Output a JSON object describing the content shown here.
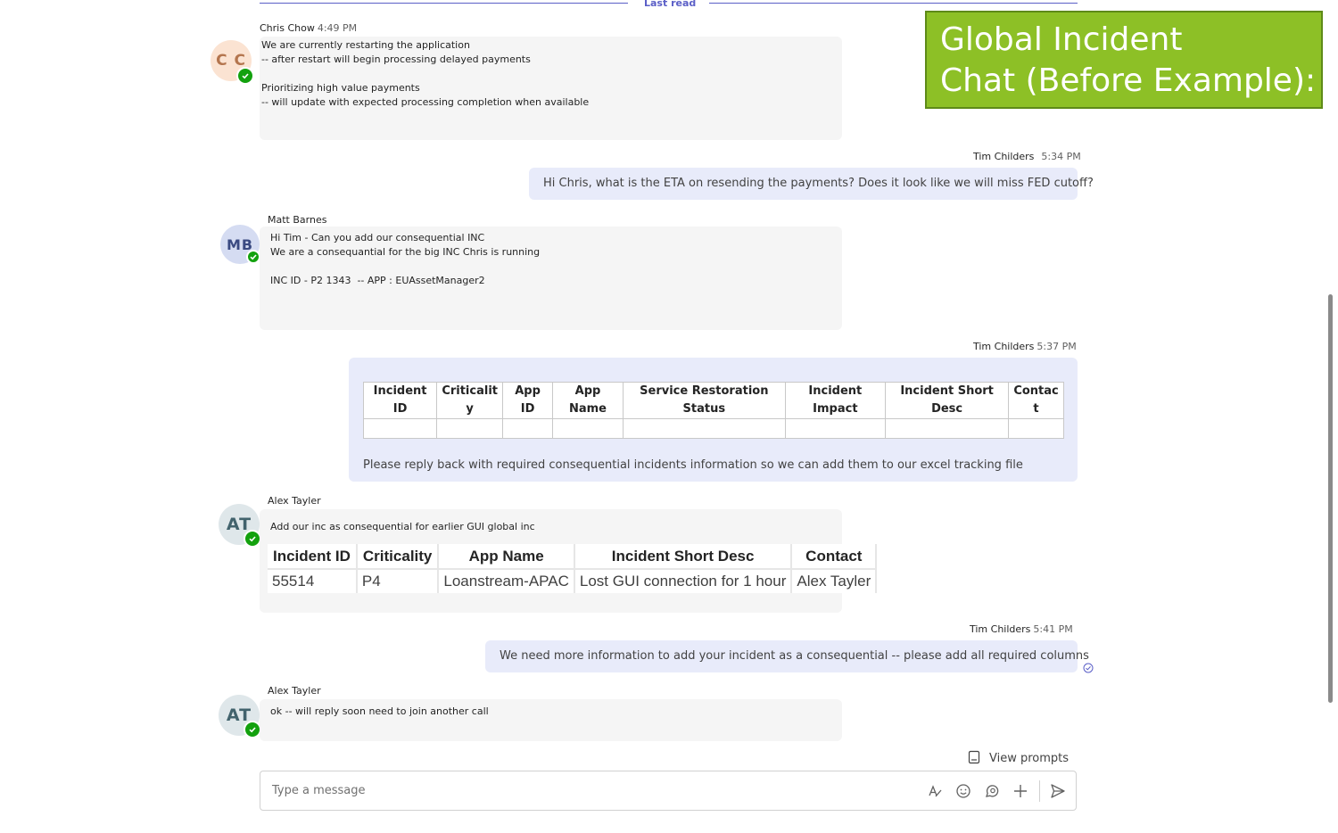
{
  "divider": {
    "label": "Last read"
  },
  "overlay": {
    "line1": "Global Incident",
    "line2": "Chat (Before Example):"
  },
  "messages": {
    "m1": {
      "sender": "Chris Chow",
      "time": "4:49 PM",
      "initials": "C C",
      "lines": [
        "We are currently restarting the application",
        "-- after restart will begin processing delayed payments",
        "Prioritizing high value payments",
        "-- will update with expected processing completion when available"
      ]
    },
    "m2": {
      "sender": "Tim Childers",
      "time": "5:34 PM",
      "text": "Hi Chris, what is the ETA on resending the payments? Does it look like we will miss FED cutoff?"
    },
    "m3": {
      "sender": "Matt Barnes",
      "initials": "MB",
      "lines": [
        "Hi Tim - Can you add our consequential INC",
        "We are a consequantial for the big INC Chris is running",
        "INC ID - P2 1343  -- APP : EUAssetManager2"
      ]
    },
    "m4": {
      "sender": "Tim Childers",
      "time": "5:37 PM",
      "headers": [
        [
          "Incident",
          "ID"
        ],
        [
          "Criticalit",
          "y"
        ],
        [
          "App",
          "ID"
        ],
        [
          "App",
          "Name"
        ],
        [
          "Service Restoration",
          "Status"
        ],
        [
          "Incident",
          "Impact"
        ],
        [
          "Incident Short",
          "Desc"
        ],
        [
          "Contac",
          "t"
        ]
      ],
      "footer": "Please reply back with required consequential incidents information so we can add them to our excel tracking file"
    },
    "m5": {
      "sender": "Alex Tayler",
      "initials": "AT",
      "intro": "Add our inc as consequential for earlier GUI global inc",
      "headers": [
        "Incident ID",
        "Criticality",
        "App Name",
        "Incident Short Desc",
        "Contact"
      ],
      "row": [
        "55514",
        "P4",
        "Loanstream-APAC",
        "Lost GUI connection for 1 hour",
        "Alex Tayler"
      ]
    },
    "m6": {
      "sender": "Tim Childers",
      "time": "5:41 PM",
      "text": "We need more information to add your incident as a consequential -- please add all required columns"
    },
    "m7": {
      "sender": "Alex Tayler",
      "initials": "AT",
      "text": "ok -- will reply soon need to join another call"
    }
  },
  "prompts": {
    "label": "View prompts"
  },
  "compose": {
    "placeholder": "Type a message"
  },
  "icons": [
    "format-icon",
    "emoji-icon",
    "loop-icon",
    "add-icon",
    "send-icon",
    "seen-icon",
    "prompts-icon",
    "presence-available-icon"
  ],
  "colors": {
    "accent": "#5b5fc7",
    "available": "#13a10e",
    "overlay": "#8dc026",
    "outgoing": "#e8ebfa",
    "incoming": "#f5f5f5"
  }
}
